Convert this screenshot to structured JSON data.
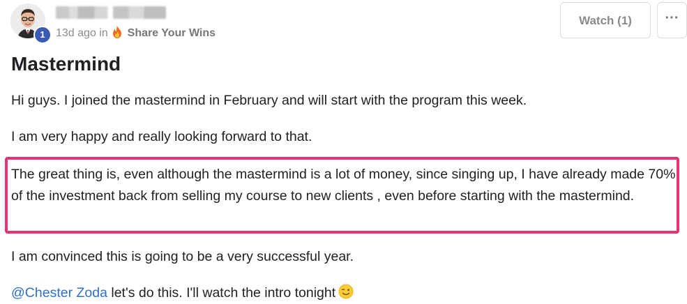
{
  "author": {
    "name": "",
    "level": "1"
  },
  "meta": {
    "time": "13d ago in",
    "category_icon": "fire-icon",
    "category": "Share Your Wins"
  },
  "actions": {
    "watch_label": "Watch (1)",
    "more_label": "···"
  },
  "post": {
    "title": "Mastermind",
    "paragraphs": [
      "Hi guys. I joined the mastermind in February and will start with the program this week.",
      "I am very happy and really looking forward to that.",
      "The great thing is, even although the mastermind is a lot of money, since singing up, I have already made 70% of the investment back from selling my course to new clients , even before starting with the mastermind.",
      "I am convinced this is going to be a very successful year."
    ],
    "last_line": {
      "mention": "@Chester Zoda",
      "text": " let's do this. I'll watch the intro tonight",
      "emoji": "winking-face-emoji"
    }
  },
  "colors": {
    "highlight_border": "#e8336e",
    "mention": "#2f6fc4",
    "level_badge": "#3a5bb3"
  }
}
